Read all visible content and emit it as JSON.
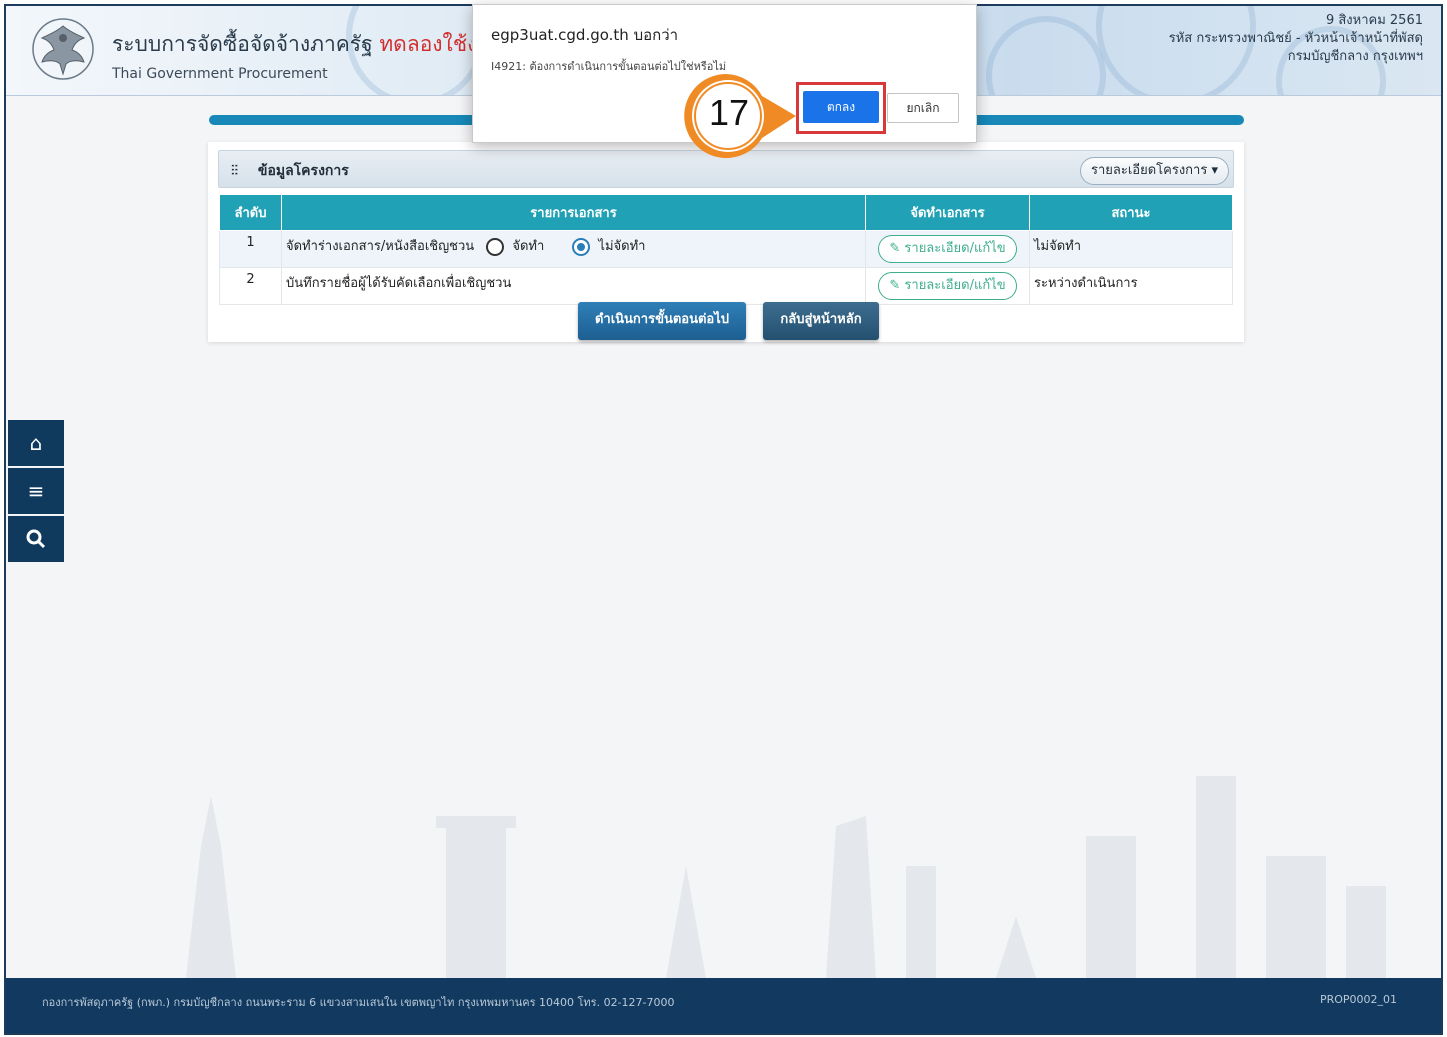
{
  "header": {
    "title_th": "ระบบการจัดซื้อจัดจ้างภาครัฐ",
    "title_test": "ทดลองใช้งาน",
    "title_en": "Thai Government Procurement",
    "date": "9 สิงหาคม 2561",
    "user_line": "รหัส กระทรวงพาณิชย์ - หัวหน้าเจ้าหน้าที่พัสดุ",
    "dept_line": "กรมบัญชีกลาง กรุงเทพฯ"
  },
  "panel": {
    "title": "ข้อมูลโครงการ",
    "detail_button": "รายละเอียดโครงการ ▾"
  },
  "table": {
    "headers": [
      "ลำดับ",
      "รายการเอกสาร",
      "จัดทำเอกสาร",
      "สถานะ"
    ],
    "rows": [
      {
        "no": "1",
        "doc": "จัดทำร่างเอกสาร/หนังสือเชิญชวน",
        "opt_make": "จัดทำ",
        "opt_nomake": "ไม่จัดทำ",
        "action": "รายละเอียด/แก้ไข",
        "status": "ไม่จัดทำ"
      },
      {
        "no": "2",
        "doc": "บันทึกรายชื่อผู้ได้รับคัดเลือกเพื่อเชิญชวน",
        "action": "รายละเอียด/แก้ไข",
        "status": "ระหว่างดำเนินการ"
      }
    ]
  },
  "buttons": {
    "next": "ดำเนินการขั้นตอนต่อไป",
    "home": "กลับสู่หน้าหลัก"
  },
  "sidenav": [
    "home-icon",
    "menu-icon",
    "search-icon"
  ],
  "footer": {
    "address": "กองการพัสดุภาครัฐ (กพภ.) กรมบัญชีกลาง ถนนพระราม 6 แขวงสามเสนใน เขตพญาไท กรุงเทพมหานคร 10400 โทร. 02-127-7000",
    "code": "PROP0002_01"
  },
  "dialog": {
    "host": "egp3uat.cgd.go.th บอกว่า",
    "message": "I4921: ต้องการดำเนินการขั้นตอนต่อไปใช่หรือไม่",
    "ok": "ตกลง",
    "cancel": "ยกเลิก"
  },
  "callout": {
    "step": "17"
  },
  "colors": {
    "header_bar": "#1788b7",
    "table_head": "#21a1b5",
    "footer": "#123a60",
    "dialog_ok": "#1a73e8",
    "highlight": "#d9383a",
    "callout": "#f08a24"
  }
}
